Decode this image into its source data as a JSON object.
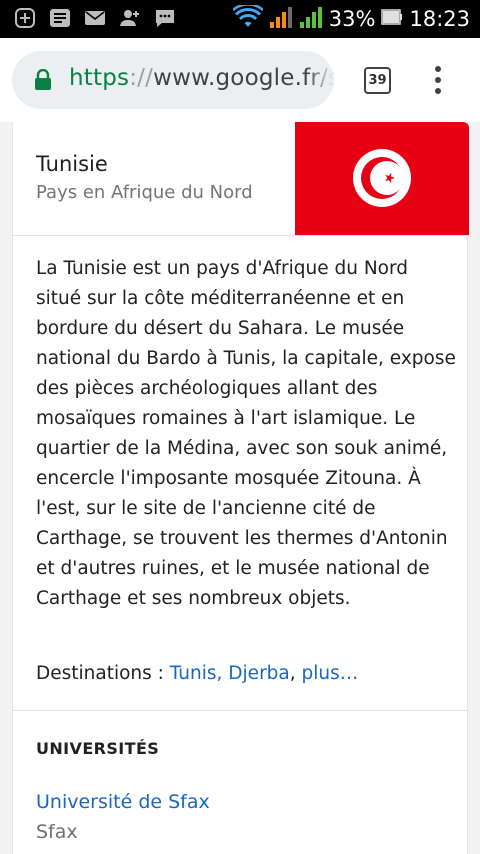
{
  "status_bar": {
    "icons": [
      "add-box-icon",
      "notification-icon",
      "mail-icon",
      "person-add-icon",
      "message-icon"
    ],
    "battery": "33%",
    "time": "18:23"
  },
  "browser": {
    "url_scheme": "https",
    "url_sep": "://",
    "url_host": "www.google.fr/s",
    "tab_count": "39"
  },
  "entity": {
    "title": "Tunisie",
    "subtitle": "Pays en Afrique du Nord",
    "description": "La Tunisie est un pays d'Afrique du Nord situé sur la côte méditerranéenne et en bordure du désert du Sahara. Le musée national du Bardo à Tunis, la capitale, expose des pièces archéologiques allant des mosaïques romaines à l'art islamique. Le quartier de la Médina, avec son souk animé, encercle l'imposante mosquée Zitouna. À l'est, sur le site de l'ancienne cité de Carthage, se trouvent les thermes d'Antonin et d'autres ruines, et le musée national de Carthage et ses nombreux objets.",
    "destinations_label": "Destinations : ",
    "destinations": [
      "Tunis",
      "Djerba"
    ],
    "destinations_sep": ", ",
    "more_label": "plus…"
  },
  "universities": {
    "title": "UNIVERSITÉS",
    "items": [
      {
        "name": "Université de Sfax",
        "city": "Sfax"
      }
    ]
  },
  "colors": {
    "flag_red": "#e70013",
    "link_blue": "#1a66c5",
    "secure_green": "#0b8043"
  }
}
